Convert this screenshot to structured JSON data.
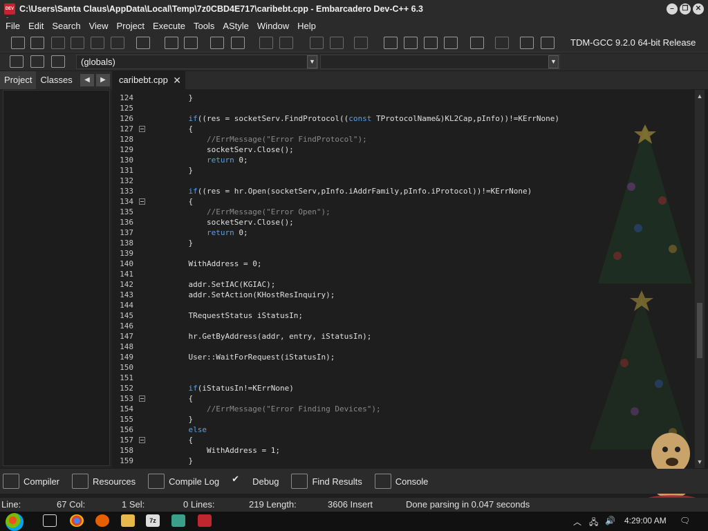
{
  "window": {
    "title": "C:\\Users\\Santa Claus\\AppData\\Local\\Temp\\7z0CBD4E717\\caribebt.cpp - Embarcadero Dev-C++ 6.3",
    "app_icon_text": "DEV C++"
  },
  "menu": [
    "File",
    "Edit",
    "Search",
    "View",
    "Project",
    "Execute",
    "Tools",
    "AStyle",
    "Window",
    "Help"
  ],
  "toolbar": {
    "compiler": "TDM-GCC 9.2.0 64-bit Release",
    "globals": "(globals)"
  },
  "left_panel": {
    "tabs": [
      "Project",
      "Classes"
    ]
  },
  "editor": {
    "tab_label": "caribebt.cpp",
    "lines": [
      {
        "n": "124",
        "code": "    }"
      },
      {
        "n": "125",
        "code": ""
      },
      {
        "n": "126",
        "code": "    if((res = socketServ.FindProtocol((const TProtocolName&)KL2Cap,pInfo))!=KErrNone)"
      },
      {
        "n": "127",
        "code": "    {"
      },
      {
        "n": "128",
        "code": "        //ErrMessage(\"Error FindProtocol\");"
      },
      {
        "n": "129",
        "code": "        socketServ.Close();"
      },
      {
        "n": "130",
        "code": "        return 0;"
      },
      {
        "n": "131",
        "code": "    }"
      },
      {
        "n": "132",
        "code": ""
      },
      {
        "n": "133",
        "code": "    if((res = hr.Open(socketServ,pInfo.iAddrFamily,pInfo.iProtocol))!=KErrNone)"
      },
      {
        "n": "134",
        "code": "    {"
      },
      {
        "n": "135",
        "code": "        //ErrMessage(\"Error Open\");"
      },
      {
        "n": "136",
        "code": "        socketServ.Close();"
      },
      {
        "n": "137",
        "code": "        return 0;"
      },
      {
        "n": "138",
        "code": "    }"
      },
      {
        "n": "139",
        "code": ""
      },
      {
        "n": "140",
        "code": "    WithAddress = 0;"
      },
      {
        "n": "141",
        "code": ""
      },
      {
        "n": "142",
        "code": "    addr.SetIAC(KGIAC);"
      },
      {
        "n": "143",
        "code": "    addr.SetAction(KHostResInquiry);"
      },
      {
        "n": "144",
        "code": ""
      },
      {
        "n": "145",
        "code": "    TRequestStatus iStatusIn;"
      },
      {
        "n": "146",
        "code": ""
      },
      {
        "n": "147",
        "code": "    hr.GetByAddress(addr, entry, iStatusIn);"
      },
      {
        "n": "148",
        "code": ""
      },
      {
        "n": "149",
        "code": "    User::WaitForRequest(iStatusIn);"
      },
      {
        "n": "150",
        "code": ""
      },
      {
        "n": "151",
        "code": ""
      },
      {
        "n": "152",
        "code": "    if(iStatusIn!=KErrNone)"
      },
      {
        "n": "153",
        "code": "    {"
      },
      {
        "n": "154",
        "code": "        //ErrMessage(\"Error Finding Devices\");"
      },
      {
        "n": "155",
        "code": "    }"
      },
      {
        "n": "156",
        "code": "    else"
      },
      {
        "n": "157",
        "code": "    {"
      },
      {
        "n": "158",
        "code": "        WithAddress = 1;"
      },
      {
        "n": "159",
        "code": "    }"
      }
    ]
  },
  "bottom_tabs": [
    "Compiler",
    "Resources",
    "Compile Log",
    "Debug",
    "Find Results",
    "Console"
  ],
  "status": {
    "line_label": "Line:",
    "line_value": "67 Col:",
    "col_value": "1 Sel:",
    "sel_value": "0 Lines:",
    "lines_value": "219 Length:",
    "length_value": "3606 Insert",
    "message": "Done parsing in 0.047 seconds"
  },
  "taskbar": {
    "clock": "4:29:00 AM"
  },
  "colors": {
    "keyword": "#5aa0e8",
    "comment": "#8a8a8a",
    "background": "#1e1e1e"
  }
}
